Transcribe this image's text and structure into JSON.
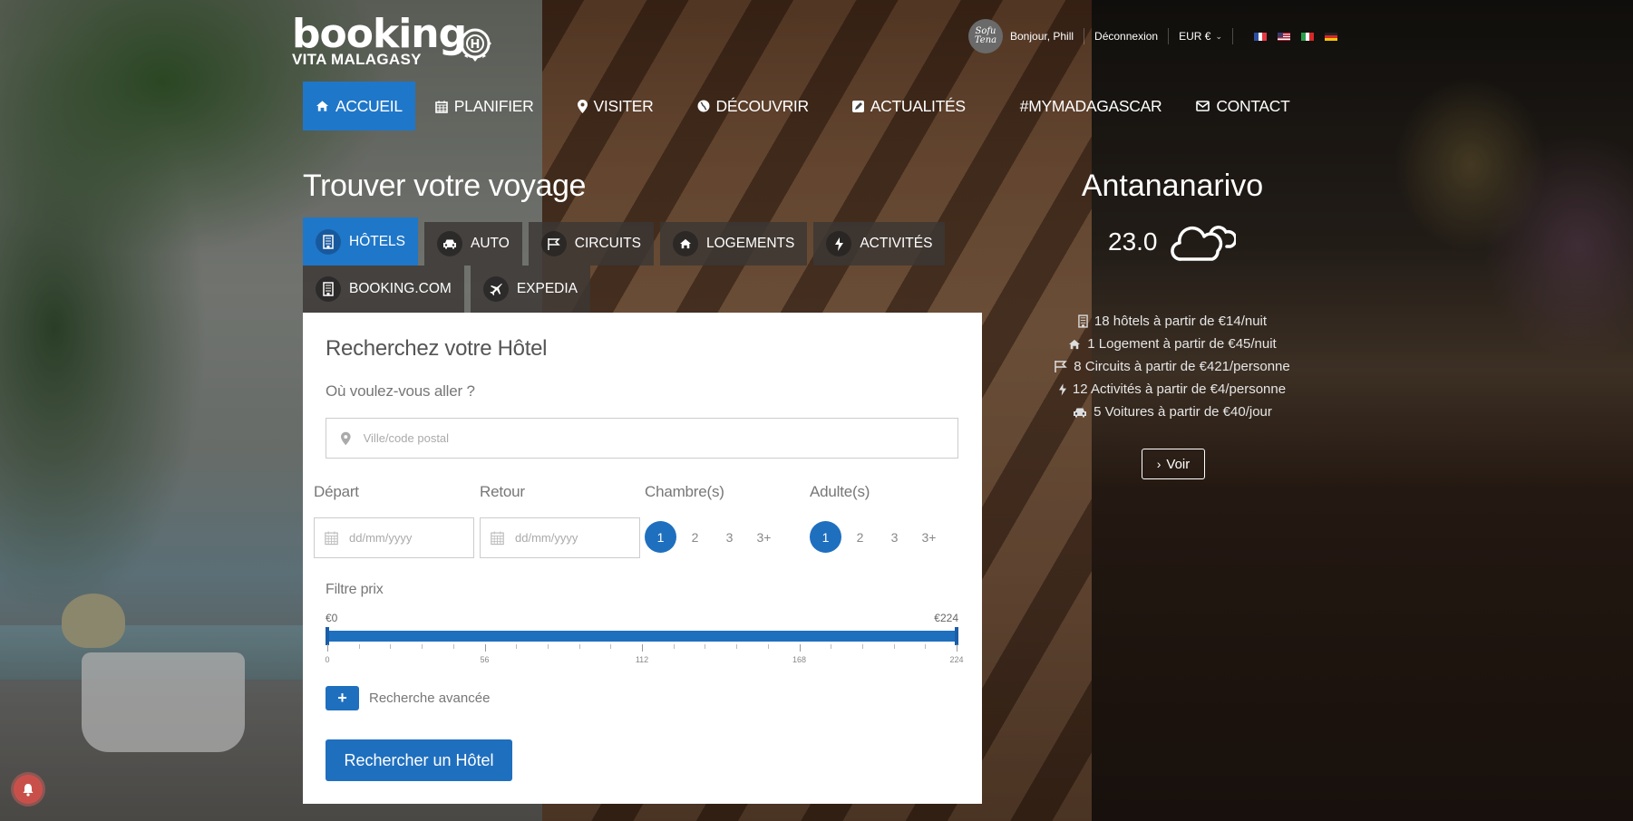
{
  "brand": {
    "name": "booking",
    "subtitle": "VITA MALAGASY",
    "badge_letter": "H"
  },
  "topbar": {
    "avatar_text": "Sofu Tena",
    "greeting": "Bonjour, Phill",
    "logout": "Déconnexion",
    "currency": "EUR €",
    "languages": [
      "fr",
      "en",
      "it",
      "de"
    ]
  },
  "nav": {
    "items": [
      {
        "label": "ACCUEIL",
        "icon": "home-icon",
        "active": true
      },
      {
        "label": "PLANIFIER",
        "icon": "calendar-icon"
      },
      {
        "label": "VISITER",
        "icon": "map-marker-icon"
      },
      {
        "label": "DÉCOUVRIR",
        "icon": "globe-icon"
      },
      {
        "label": "ACTUALITÉS",
        "icon": "edit-icon"
      },
      {
        "label": "#MYMADAGASCAR",
        "icon": ""
      },
      {
        "label": "CONTACT",
        "icon": "envelope-icon"
      }
    ]
  },
  "search": {
    "title": "Trouver votre voyage",
    "tabs": [
      {
        "label": "HÔTELS",
        "icon": "building-icon",
        "active": true
      },
      {
        "label": "AUTO",
        "icon": "car-icon"
      },
      {
        "label": "CIRCUITS",
        "icon": "flag-icon"
      },
      {
        "label": "LOGEMENTS",
        "icon": "home-icon"
      },
      {
        "label": "ACTIVITÉS",
        "icon": "bolt-icon"
      },
      {
        "label": "BOOKING.COM",
        "icon": "building-icon"
      },
      {
        "label": "EXPEDIA",
        "icon": "plane-icon"
      }
    ],
    "form": {
      "heading": "Recherchez votre Hôtel",
      "destination_label": "Où voulez-vous aller ?",
      "destination_placeholder": "Ville/code postal",
      "destination_value": "",
      "depart_label": "Départ",
      "depart_placeholder": "dd/mm/yyyy",
      "retour_label": "Retour",
      "retour_placeholder": "dd/mm/yyyy",
      "rooms_label": "Chambre(s)",
      "rooms_options": [
        "1",
        "2",
        "3",
        "3+"
      ],
      "rooms_selected": "1",
      "adults_label": "Adulte(s)",
      "adults_options": [
        "1",
        "2",
        "3",
        "3+"
      ],
      "adults_selected": "1",
      "price_label": "Filtre prix",
      "price_min_label": "€0",
      "price_max_label": "€224",
      "price_range": {
        "min": 0,
        "max": 224,
        "selected_low": 0,
        "selected_high": 224
      },
      "price_ticks": [
        "0",
        "56",
        "112",
        "168",
        "224"
      ],
      "advanced_label": "Recherche avancée",
      "submit_label": "Rechercher un Hôtel"
    }
  },
  "weather": {
    "city": "Antananarivo",
    "temperature": "23.0",
    "condition_icon": "cloudy-icon"
  },
  "summary": {
    "rows": [
      {
        "icon": "building-icon",
        "text": "18 hôtels à partir de €14/nuit"
      },
      {
        "icon": "home-icon",
        "text": "1 Logement à partir de €45/nuit"
      },
      {
        "icon": "flag-icon",
        "text": "8 Circuits à partir de €421/personne"
      },
      {
        "icon": "bolt-icon",
        "text": "12 Activités à partir de €4/personne"
      },
      {
        "icon": "car-icon",
        "text": "5 Voitures à partir de €40/jour"
      }
    ],
    "button_label": "Voir"
  },
  "colors": {
    "accent": "#1f77c9",
    "button": "#1f6fbf",
    "notification": "#c9504a"
  }
}
